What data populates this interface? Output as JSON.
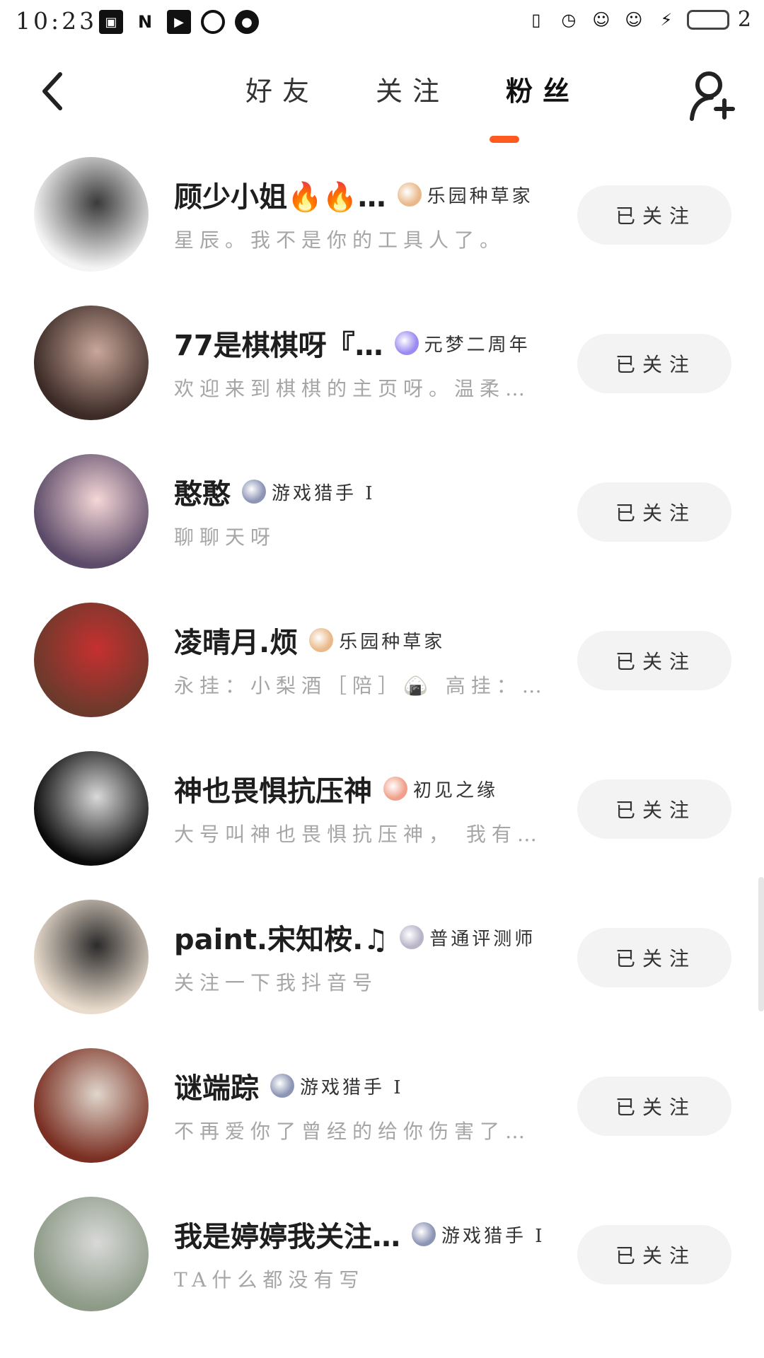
{
  "status_bar": {
    "time": "10:23",
    "left_icons": [
      "image-icon",
      "n-letter-icon",
      "play-icon",
      "blocked-icon",
      "account-icon"
    ],
    "right_icons": [
      "vibrate-icon",
      "alarm-icon",
      "kitty-sticker-icon",
      "kitty-sticker-icon",
      "charging-icon"
    ],
    "battery_text": "2"
  },
  "nav": {
    "back_icon": "chevron-left-icon",
    "tabs": [
      {
        "label": "好友",
        "active": false
      },
      {
        "label": "关注",
        "active": false
      },
      {
        "label": "粉丝",
        "active": true
      }
    ],
    "accent_color": "#ff5a1f",
    "add_icon": "add-friend-icon"
  },
  "fans": [
    {
      "name": "顾少小姐🔥🔥…",
      "badge": "乐园种草家",
      "bio": "星辰。我不是你的工具人了。",
      "button": "已关注",
      "avatar_colors": [
        "#f4f4f4",
        "#3a3a3a"
      ],
      "badge_color": "#e9b98a"
    },
    {
      "name": "77是棋棋呀『…",
      "badge": "元梦二周年",
      "bio": "欢迎来到棋棋的主页呀。温柔…",
      "button": "已关注",
      "avatar_colors": [
        "#3b2a26",
        "#c9a79a"
      ],
      "badge_color": "#9b8bf0"
    },
    {
      "name": "憨憨",
      "badge": "游戏猎手 I",
      "bio": "聊聊天呀",
      "button": "已关注",
      "avatar_colors": [
        "#5b4a68",
        "#f5d7d7"
      ],
      "badge_color": "#8d95b5"
    },
    {
      "name": "凌晴月.烦",
      "badge": "乐园种草家",
      "bio": "永挂：小梨酒［陪］🍙 高挂：…",
      "button": "已关注",
      "avatar_colors": [
        "#6b3a2c",
        "#c63030"
      ],
      "badge_color": "#e9b98a"
    },
    {
      "name": "神也畏惧抗压神",
      "badge": "初见之缘",
      "bio": "大号叫神也畏惧抗压神， 我有…",
      "button": "已关注",
      "avatar_colors": [
        "#0b0b0b",
        "#d9d9d9"
      ],
      "badge_color": "#f0a08a"
    },
    {
      "name": "paint.宋知桉.♫",
      "badge": "普通评测师",
      "bio": "关注一下我抖音号",
      "button": "已关注",
      "avatar_colors": [
        "#e9dccd",
        "#2b2b2b"
      ],
      "badge_color": "#b9b4c8"
    },
    {
      "name": "谜端踪",
      "badge": "游戏猎手 I",
      "bio": "不再爱你了曾经的给你伤害了…",
      "button": "已关注",
      "avatar_colors": [
        "#7a2f22",
        "#e0d6cc"
      ],
      "badge_color": "#8d95b5"
    },
    {
      "name": "我是婷婷我关注…",
      "badge": "游戏猎手 I",
      "bio": "TA什么都没有写",
      "button": "已关注",
      "avatar_colors": [
        "#8c9a86",
        "#d9d9d9"
      ],
      "badge_color": "#8d95b5"
    }
  ]
}
